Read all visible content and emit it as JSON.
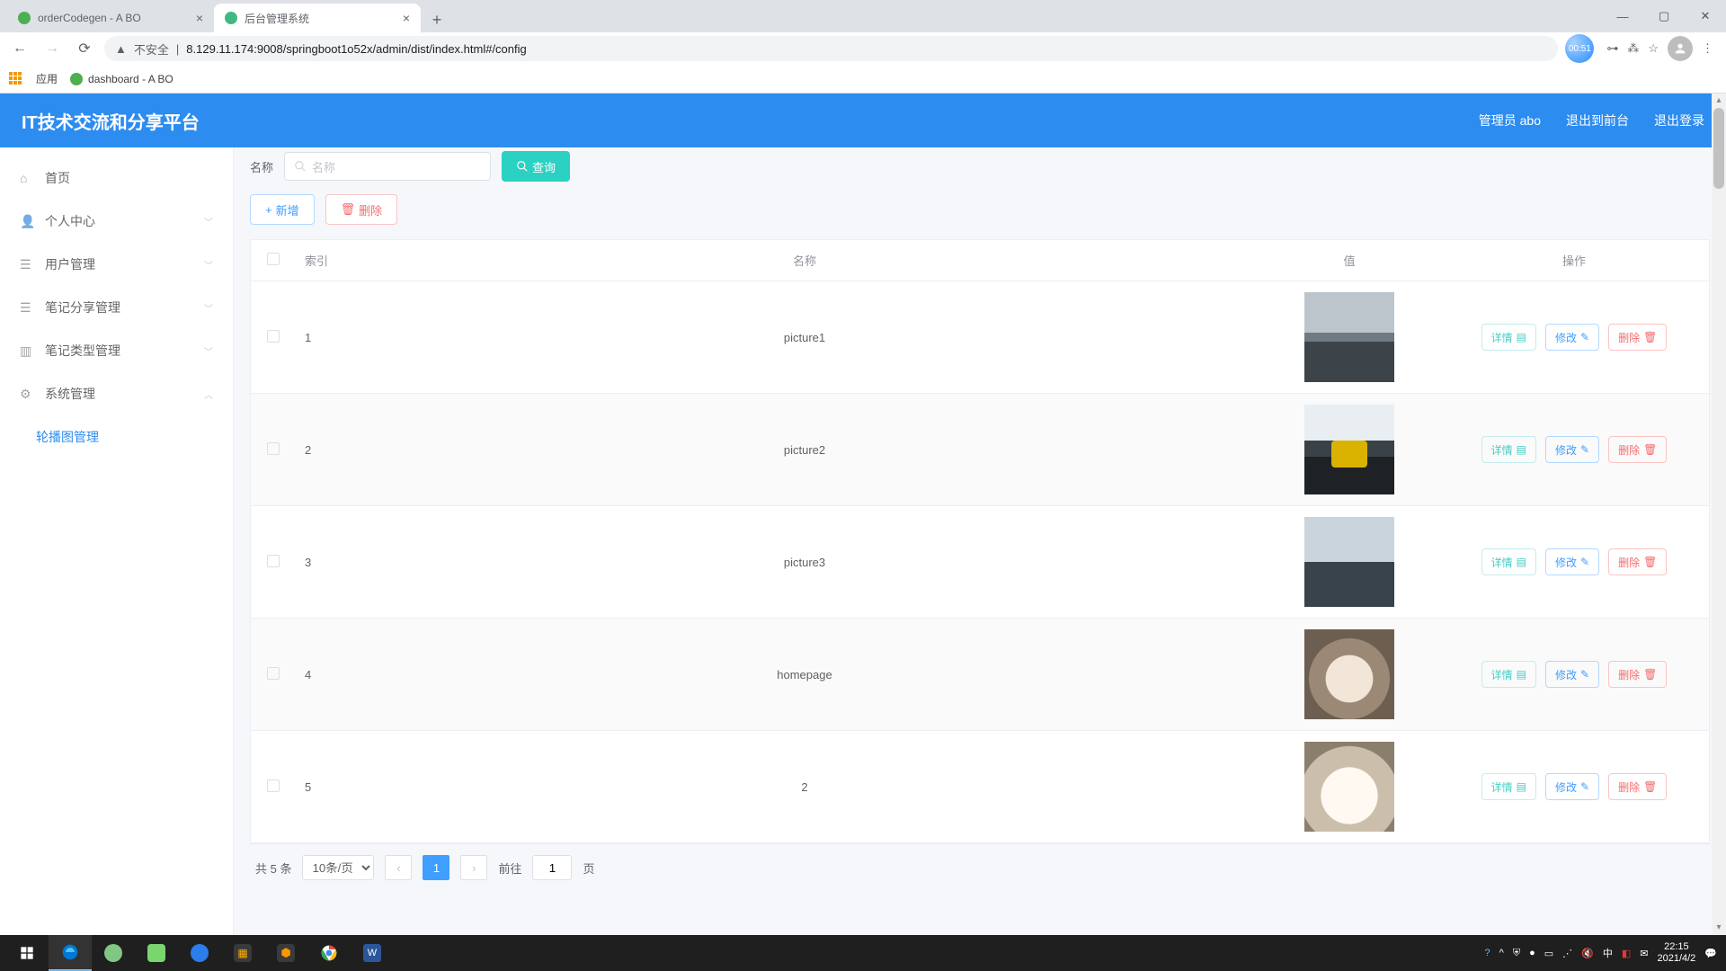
{
  "browser": {
    "tabs": [
      {
        "title": "orderCodegen - A BO"
      },
      {
        "title": "后台管理系统"
      }
    ],
    "security_label": "不安全",
    "url": "8.129.11.174:9008/springboot1o52x/admin/dist/index.html#/config",
    "time_bubble": "00:51",
    "bookmarks_label": "应用",
    "bookmark_1": "dashboard - A BO"
  },
  "header": {
    "logo": "IT技术交流和分享平台",
    "user_label": "管理员 abo",
    "front_label": "退出到前台",
    "logout_label": "退出登录"
  },
  "sidebar": {
    "home": "首页",
    "profile": "个人中心",
    "users": "用户管理",
    "notes": "笔记分享管理",
    "types": "笔记类型管理",
    "system": "系统管理",
    "carousel": "轮播图管理"
  },
  "filter": {
    "label": "名称",
    "placeholder": "名称",
    "query": "查询"
  },
  "actions": {
    "add": "新增",
    "delete": "删除"
  },
  "table": {
    "headers": {
      "index": "索引",
      "name": "名称",
      "value": "值",
      "ops": "操作"
    },
    "rows": [
      {
        "index": "1",
        "name": "picture1"
      },
      {
        "index": "2",
        "name": "picture2"
      },
      {
        "index": "3",
        "name": "picture3"
      },
      {
        "index": "4",
        "name": "homepage"
      },
      {
        "index": "5",
        "name": "2"
      }
    ],
    "ops": {
      "detail": "详情",
      "edit": "修改",
      "delete": "删除"
    }
  },
  "pager": {
    "total": "共 5 条",
    "page_size": "10条/页",
    "current": "1",
    "goto_prefix": "前往",
    "goto_value": "1",
    "goto_suffix": "页"
  },
  "taskbar": {
    "time": "22:15",
    "date": "2021/4/2",
    "ime": "中"
  }
}
